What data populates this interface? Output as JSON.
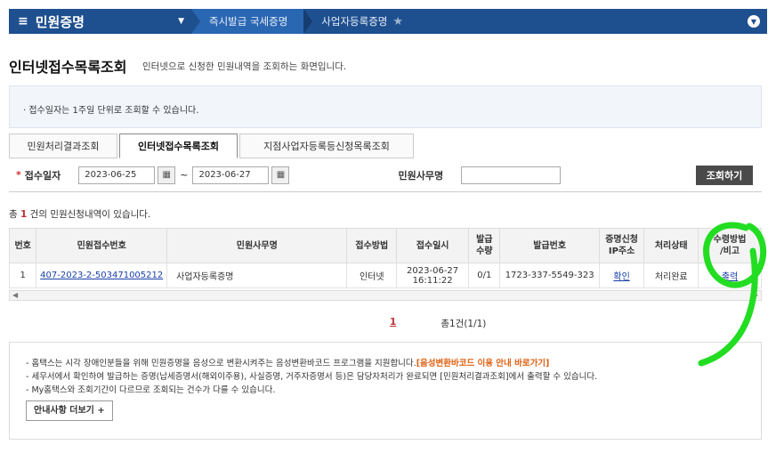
{
  "nav": {
    "menu_label": "민원증명",
    "crumb1": "즉시발급 국세증명",
    "crumb2": "사업자등록증명"
  },
  "page": {
    "title": "인터넷접수목록조회",
    "subtitle": "인터넷으로 신청한 민원내역을 조회하는 화면입니다."
  },
  "notice": "· 접수일자는 1주일 단위로 조회할 수 있습니다.",
  "tabs": [
    {
      "label": "민원처리결과조회",
      "active": false
    },
    {
      "label": "인터넷접수목록조회",
      "active": true
    },
    {
      "label": "지점사업자등록등신청목록조회",
      "active": false
    }
  ],
  "search": {
    "date_label": "접수일자",
    "date_from": "2023-06-25",
    "date_to": "2023-06-27",
    "tilde": "~",
    "office_label": "민원사무명",
    "office_value": "",
    "button_label": "조회하기"
  },
  "result": {
    "prefix": "총",
    "count": "1",
    "suffix": "건의 민원신청내역이 있습니다."
  },
  "table": {
    "headers": [
      "번호",
      "민원접수번호",
      "민원사무명",
      "접수방법",
      "접수일시",
      "발급\n수량",
      "발급번호",
      "증명신청\nIP주소",
      "처리상태",
      "수령방법\n/비고"
    ],
    "rows": [
      [
        "1",
        "407-2023-2-503471005212",
        "사업자등록증명",
        "인터넷",
        "2023-06-27\n16:11:22",
        "0/1",
        "1723-337-5549-323",
        "확인",
        "처리완료",
        "출력"
      ]
    ]
  },
  "pager": {
    "current": "1",
    "total": "총1건(1/1)"
  },
  "guide": {
    "line1_text": "- 홈택스는 시각 장애인분들을 위해 민원증명을 음성으로 변환시켜주는 음성변환바코드 프로그램을 지원합니다.",
    "line1_link": "[음성변환바코드 이용 안내 바로가기]",
    "line2": "- 세무서에서 확인하여 발급하는 증명(납세증명서(해외이주용), 사실증명, 거주자증명서 등)은 담당자처리가 완료되면 [민원처리결과조회]에서 출력할 수 있습니다.",
    "line3": "- My홈택스와 조회기간이 다르므로 조회되는 건수가 다를 수 있습니다.",
    "more_label": "안내사항 더보기 +"
  },
  "colors": {
    "nav_bg": "#1e4f8f",
    "annotation": "#22dd22",
    "required": "#d03030"
  }
}
